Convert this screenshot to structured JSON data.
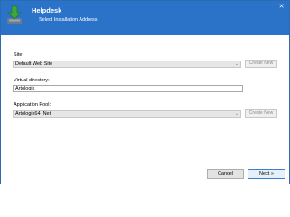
{
  "header": {
    "title": "Helpdesk",
    "subtitle": "Select Installation Address",
    "close_glyph": "✕"
  },
  "form": {
    "site": {
      "label": "Site:",
      "value": "Default Web Site",
      "create_new_label": "Create New"
    },
    "virtual_directory": {
      "label": "Virtual directory:",
      "value": "Artologik"
    },
    "application_pool": {
      "label": "Application Pool:",
      "value": "Artologik64 .Net",
      "create_new_label": "Create New"
    }
  },
  "footer": {
    "cancel_label": "Cancel",
    "next_label": "Next »"
  },
  "colors": {
    "header_bg": "#2a73c9",
    "icon_green": "#3da83a",
    "icon_tray": "#6b7b8c"
  },
  "icons": {
    "app_icon": "install-arrow-icon",
    "dropdown_icon": "chevron-down-icon",
    "close_icon": "close-icon"
  }
}
